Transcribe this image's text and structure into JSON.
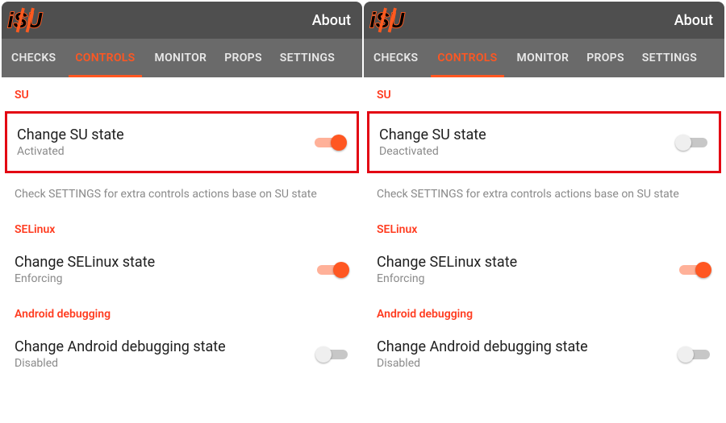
{
  "colors": {
    "accent": "#ff5722",
    "highlight": "#e30613"
  },
  "screens": [
    {
      "id": "left",
      "header": {
        "about": "About",
        "logo_text": "iSU"
      },
      "tabs": [
        {
          "label": "CHECKS",
          "active": false
        },
        {
          "label": "CONTROLS",
          "active": true
        },
        {
          "label": "MONITOR",
          "active": false
        },
        {
          "label": "PROPS",
          "active": false
        },
        {
          "label": "SETTINGS",
          "active": false
        }
      ],
      "su_section_label": "SU",
      "su_row": {
        "title": "Change SU state",
        "sub": "Activated",
        "on": true,
        "highlighted": true
      },
      "su_hint": "Check SETTINGS for extra controls actions base on SU state",
      "selinux_section_label": "SELinux",
      "selinux_row": {
        "title": "Change SELinux state",
        "sub": "Enforcing",
        "on": true
      },
      "adbg_section_label": "Android debugging",
      "adbg_row": {
        "title": "Change Android debugging state",
        "sub": "Disabled",
        "on": false
      }
    },
    {
      "id": "right",
      "header": {
        "about": "About",
        "logo_text": "iSU"
      },
      "tabs": [
        {
          "label": "CHECKS",
          "active": false
        },
        {
          "label": "CONTROLS",
          "active": true
        },
        {
          "label": "MONITOR",
          "active": false
        },
        {
          "label": "PROPS",
          "active": false
        },
        {
          "label": "SETTINGS",
          "active": false
        }
      ],
      "su_section_label": "SU",
      "su_row": {
        "title": "Change SU state",
        "sub": "Deactivated",
        "on": false,
        "highlighted": true
      },
      "su_hint": "Check SETTINGS for extra controls actions base on SU state",
      "selinux_section_label": "SELinux",
      "selinux_row": {
        "title": "Change SELinux state",
        "sub": "Enforcing",
        "on": true
      },
      "adbg_section_label": "Android debugging",
      "adbg_row": {
        "title": "Change Android debugging state",
        "sub": "Disabled",
        "on": false
      }
    }
  ]
}
